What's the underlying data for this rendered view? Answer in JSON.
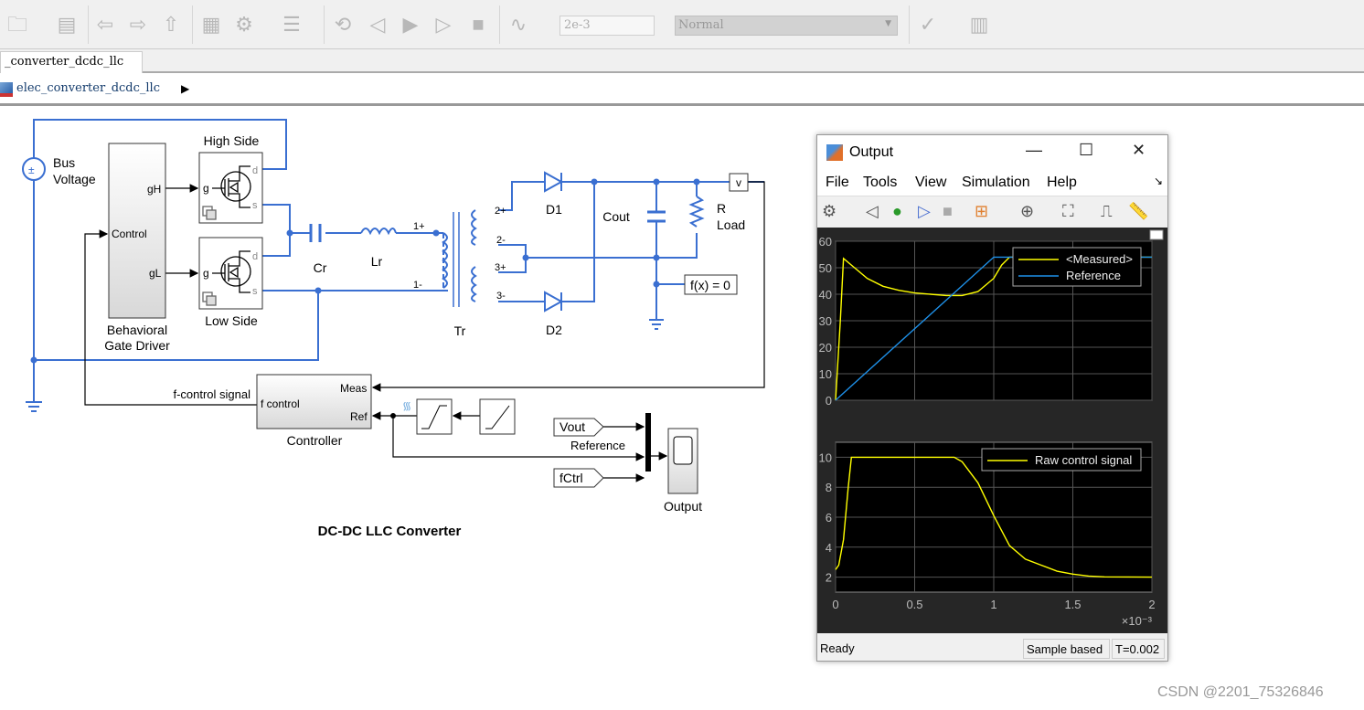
{
  "toolbar": {
    "icons": [
      "open-folder-icon",
      "save-icon",
      "back-icon",
      "forward-icon",
      "up-icon",
      "library-icon",
      "gear-icon",
      "model-config-icon",
      "step-back-icon",
      "run-icon",
      "step-forward-icon",
      "stop-icon",
      "data-inspector-icon",
      "check-icon",
      "build-icon"
    ],
    "stop_time": "2e-3",
    "sim_mode": "Normal"
  },
  "tab": {
    "label": "_converter_dcdc_llc"
  },
  "breadcrumb": {
    "label": "elec_converter_dcdc_llc"
  },
  "diagram": {
    "title": "DC-DC LLC Converter",
    "bus_voltage": [
      "Bus",
      "Voltage"
    ],
    "gate_driver": {
      "name": [
        "Behavioral",
        "Gate Driver"
      ],
      "ports": [
        "gH",
        "Control",
        "gL"
      ]
    },
    "high_side": "High Side",
    "low_side": "Low Side",
    "mosfet_ports": [
      "g",
      "d",
      "s"
    ],
    "cr": "Cr",
    "lr": "Lr",
    "tr": "Tr",
    "d1": "D1",
    "d2": "D2",
    "cout": "Cout",
    "r_load": [
      "R",
      "Load"
    ],
    "tr_ports": [
      "1+",
      "1-",
      "2+",
      "2-",
      "3+",
      "3-"
    ],
    "sensor": "v",
    "solver": "f(x) = 0",
    "controller": {
      "name": "Controller",
      "ports": [
        "Meas",
        "Ref",
        "f control"
      ]
    },
    "f_control_signal": "f-control signal",
    "vout_tag": "Vout",
    "fctrl_tag": "fCtrl",
    "reference": "Reference",
    "scope": "Output"
  },
  "scope_window": {
    "title": "Output",
    "menu": [
      "File",
      "Tools",
      "View",
      "Simulation",
      "Help"
    ],
    "status": {
      "left": "Ready",
      "mode": "Sample based",
      "time": "T=0.002"
    },
    "x_exponent": "×10⁻³"
  },
  "chart_data": [
    {
      "type": "line",
      "xlim": [
        0,
        0.002
      ],
      "ylim": [
        0,
        60
      ],
      "grid": true,
      "legend": "top-right",
      "xticks": [
        0,
        0.0005,
        0.001,
        0.0015,
        0.002
      ],
      "yticks": [
        0,
        10,
        20,
        30,
        40,
        50,
        60
      ],
      "ytick_labels": [
        "0",
        "10",
        "20",
        "30",
        "40",
        "50",
        "60"
      ],
      "series": [
        {
          "name": "<Measured>",
          "color": "#ffff00",
          "x": [
            0,
            3e-05,
            5e-05,
            0.0001,
            0.0002,
            0.0003,
            0.0004,
            0.0005,
            0.0006,
            0.0007,
            0.0008,
            0.0009,
            0.001,
            0.00105,
            0.0011,
            0.0015,
            0.002
          ],
          "y": [
            0,
            30,
            53.5,
            51,
            46,
            43,
            41.5,
            40.5,
            40,
            39.5,
            39.5,
            41,
            46,
            51,
            54,
            54,
            54
          ]
        },
        {
          "name": "Reference",
          "color": "#1e90e8",
          "x": [
            0,
            0.001,
            0.002
          ],
          "y": [
            0,
            54,
            54
          ]
        }
      ]
    },
    {
      "type": "line",
      "xlim": [
        0,
        0.002
      ],
      "ylim": [
        1,
        11
      ],
      "grid": true,
      "legend": "top-right",
      "xticks": [
        0,
        0.0005,
        0.001,
        0.0015,
        0.002
      ],
      "xtick_labels": [
        "0",
        "0.5",
        "1",
        "1.5",
        "2"
      ],
      "yticks": [
        2,
        4,
        6,
        8,
        10
      ],
      "ytick_labels": [
        "2",
        "4",
        "6",
        "8",
        "10"
      ],
      "series": [
        {
          "name": "Raw control signal",
          "color": "#ffff00",
          "x": [
            0,
            2e-05,
            5e-05,
            8e-05,
            0.0001,
            0.0004,
            0.00075,
            0.0008,
            0.0009,
            0.001,
            0.0011,
            0.0012,
            0.0013,
            0.0014,
            0.0015,
            0.0016,
            0.0017,
            0.002
          ],
          "y": [
            2.5,
            2.8,
            4.5,
            8,
            10,
            10,
            10,
            9.7,
            8.3,
            6.1,
            4.1,
            3.2,
            2.8,
            2.4,
            2.2,
            2.07,
            2.02,
            2
          ]
        }
      ]
    }
  ],
  "colors": {
    "wire": "#3a6fd1",
    "signal": "#000000",
    "scope_bg": "#000000",
    "watermark": "#999999"
  },
  "watermark": "CSDN @2201_75326846"
}
